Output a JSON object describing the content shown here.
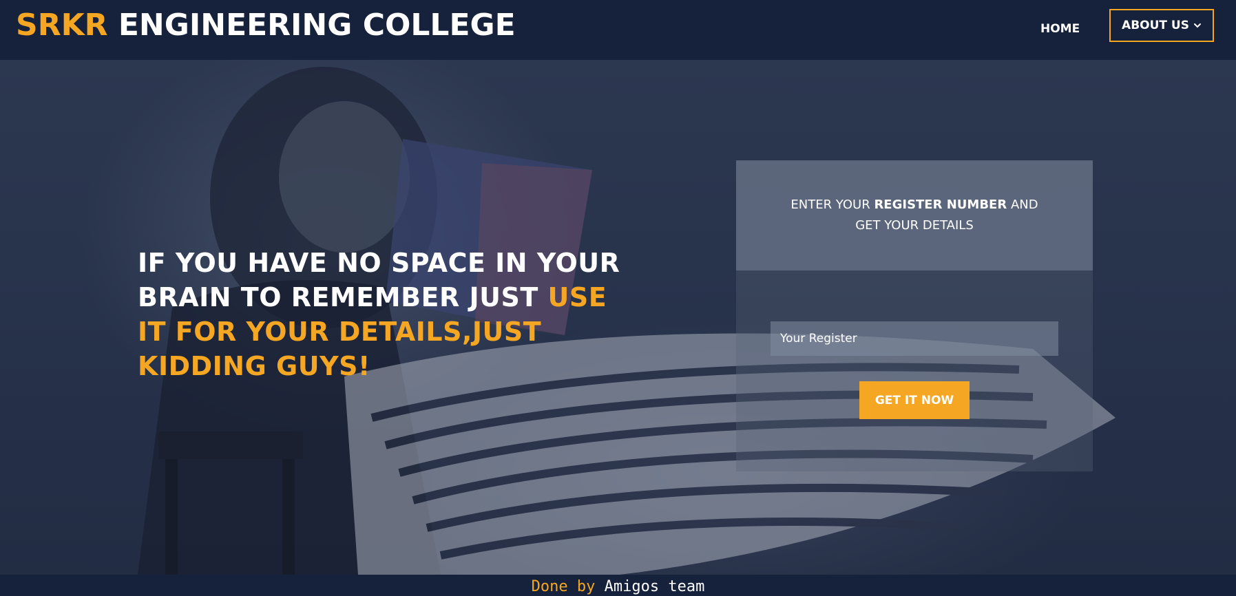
{
  "navbar": {
    "brand_accent": "SRKR",
    "brand_rest": "ENGINEERING COLLEGE",
    "home_label": "HOME",
    "about_label": "ABOUT US",
    "about_icon": "chevron-down-icon"
  },
  "hero": {
    "headline_white": "IF YOU HAVE NO SPACE IN YOUR BRAIN TO REMEMBER JUST",
    "headline_accent": "USE IT FOR YOUR DETAILS,JUST KIDDING GUYS!"
  },
  "form": {
    "intro_before": "ENTER YOUR",
    "intro_bold": "REGISTER NUMBER",
    "intro_after": "AND GET YOUR DETAILS",
    "input_placeholder": "Your Register",
    "input_value": "",
    "submit_label": "GET IT NOW"
  },
  "footer": {
    "done": "Done",
    "by": "by",
    "team": "Amigos team"
  },
  "colors": {
    "accent": "#f5a623",
    "navbar_bg": "#16213c",
    "text": "#ffffff"
  }
}
